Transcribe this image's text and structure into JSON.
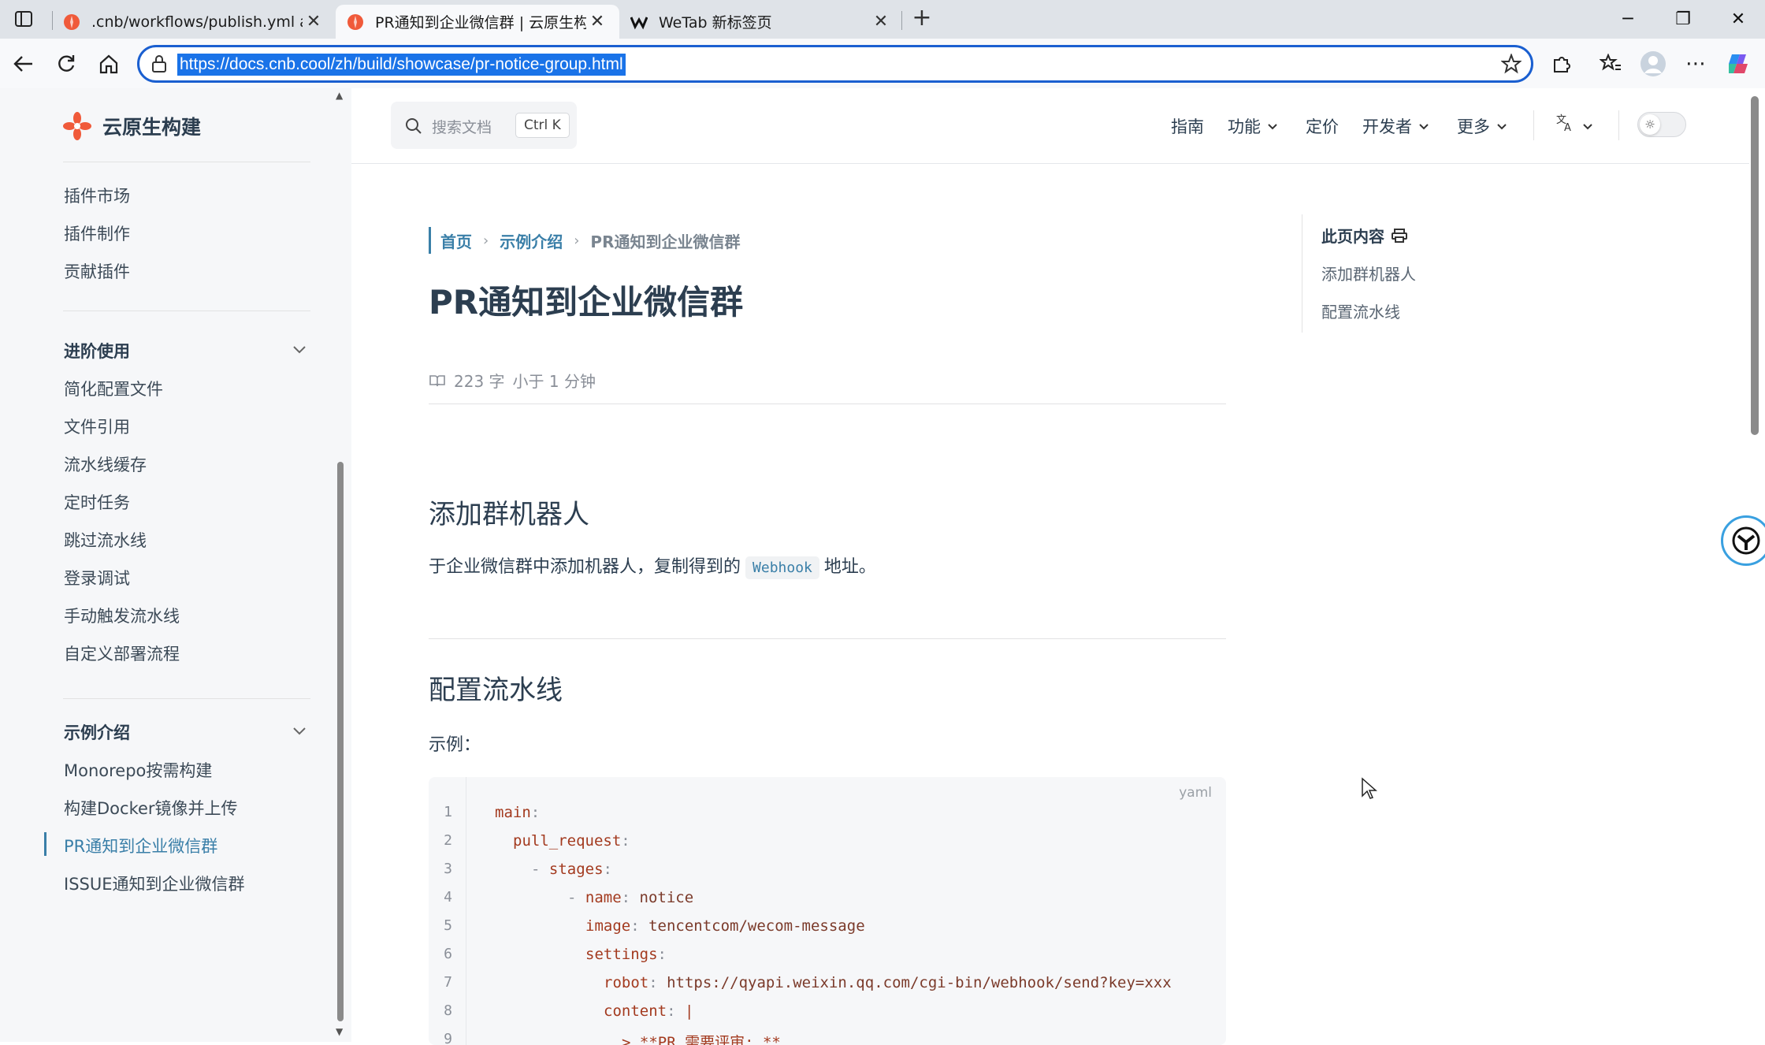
{
  "browser": {
    "tabs": [
      {
        "title": ".cnb/workflows/publish.yml at ma",
        "active": false
      },
      {
        "title": "PR通知到企业微信群 | 云原生构建",
        "active": true
      },
      {
        "title": "WeTab 新标签页",
        "active": false
      }
    ],
    "url": "https://docs.cnb.cool/zh/build/showcase/pr-notice-group.html"
  },
  "site": {
    "logo_text": "云原生构建",
    "search_placeholder": "搜索文档",
    "search_shortcut": "Ctrl K",
    "nav": [
      {
        "label": "指南",
        "has_dropdown": false
      },
      {
        "label": "功能",
        "has_dropdown": true
      },
      {
        "label": "定价",
        "has_dropdown": false
      },
      {
        "label": "开发者",
        "has_dropdown": true
      },
      {
        "label": "更多",
        "has_dropdown": true
      }
    ]
  },
  "sidebar": {
    "plugin_items": [
      "插件市场",
      "插件制作",
      "贡献插件"
    ],
    "advanced": {
      "title": "进阶使用",
      "items": [
        "简化配置文件",
        "文件引用",
        "流水线缓存",
        "定时任务",
        "跳过流水线",
        "登录调试",
        "手动触发流水线",
        "自定义部署流程"
      ]
    },
    "showcase": {
      "title": "示例介绍",
      "items": [
        "Monorepo按需构建",
        "构建Docker镜像并上传",
        "PR通知到企业微信群",
        "ISSUE通知到企业微信群"
      ],
      "active_index": 2
    }
  },
  "article": {
    "breadcrumb": {
      "home": "首页",
      "section": "示例介绍",
      "current": "PR通知到企业微信群"
    },
    "title": "PR通知到企业微信群",
    "word_count": "223 字",
    "read_time": "小于 1 分钟",
    "section1": {
      "heading": "添加群机器人",
      "text_before": "于企业微信群中添加机器人，复制得到的",
      "code": "Webhook",
      "text_after": "地址。"
    },
    "section2": {
      "heading": "配置流水线",
      "intro": "示例："
    },
    "code": {
      "language": "yaml",
      "line_numbers": [
        "1",
        "2",
        "3",
        "4",
        "5",
        "6",
        "7",
        "8",
        "9"
      ],
      "lines": [
        {
          "key": "main",
          "value": ""
        },
        {
          "key": "pull_request",
          "value": ""
        },
        {
          "key": "stages",
          "value": ""
        },
        {
          "key": "name",
          "value": "notice"
        },
        {
          "key": "image",
          "value": "tencentcom/wecom-message"
        },
        {
          "key": "settings",
          "value": ""
        },
        {
          "key": "robot",
          "value": "https://qyapi.weixin.qq.com/cgi-bin/webhook/send?key=xxx"
        },
        {
          "key": "content",
          "value": "|"
        },
        {
          "key": "",
          "value": "> **PR 需要评审: **"
        }
      ]
    }
  },
  "toc": {
    "title": "此页内容",
    "items": [
      "添加群机器人",
      "配置流水线"
    ]
  }
}
